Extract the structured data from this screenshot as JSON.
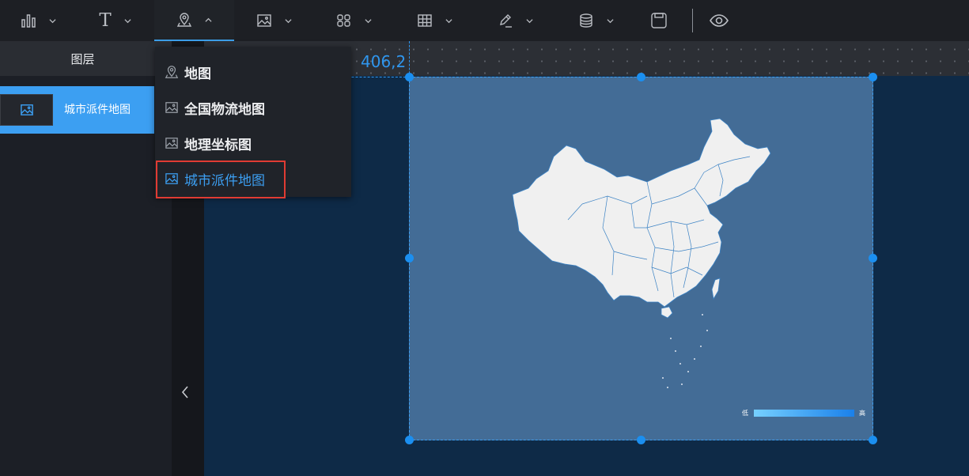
{
  "toolbar": {
    "items": [
      {
        "icon": "bar-chart-icon",
        "dropdown": true
      },
      {
        "icon": "text-icon",
        "glyph": "T",
        "dropdown": true
      },
      {
        "icon": "map-pin-icon",
        "dropdown": true,
        "active": true
      },
      {
        "icon": "image-icon",
        "dropdown": true
      },
      {
        "icon": "components-icon",
        "dropdown": true
      },
      {
        "icon": "table-icon",
        "dropdown": true
      },
      {
        "icon": "pen-icon",
        "dropdown": true
      },
      {
        "icon": "database-icon",
        "dropdown": true
      },
      {
        "icon": "save-icon",
        "dropdown": false
      },
      {
        "icon": "preview-eye-icon",
        "dropdown": false
      }
    ]
  },
  "sidebar": {
    "title": "图层",
    "layers": [
      {
        "label": "城市派件地图",
        "icon": "image-icon",
        "selected": true
      }
    ]
  },
  "dropdown_menu": {
    "items": [
      {
        "label": "地图",
        "icon": "map-pin-icon"
      },
      {
        "label": "全国物流地图",
        "icon": "image-icon"
      },
      {
        "label": "地理坐标图",
        "icon": "image-icon"
      },
      {
        "label": "城市派件地图",
        "icon": "image-icon",
        "selected": true
      }
    ]
  },
  "canvas": {
    "coordinate_readout": "406,2"
  },
  "map_widget": {
    "legend_low": "低",
    "legend_high": "高"
  },
  "colors": {
    "accent": "#3c9ff2",
    "highlight_border": "#e03b33",
    "canvas_bg": "#0e2a47",
    "map_panel_bg": "#436c96",
    "map_land": "#f0f0f0",
    "toolbar_bg": "#1d1f24"
  }
}
